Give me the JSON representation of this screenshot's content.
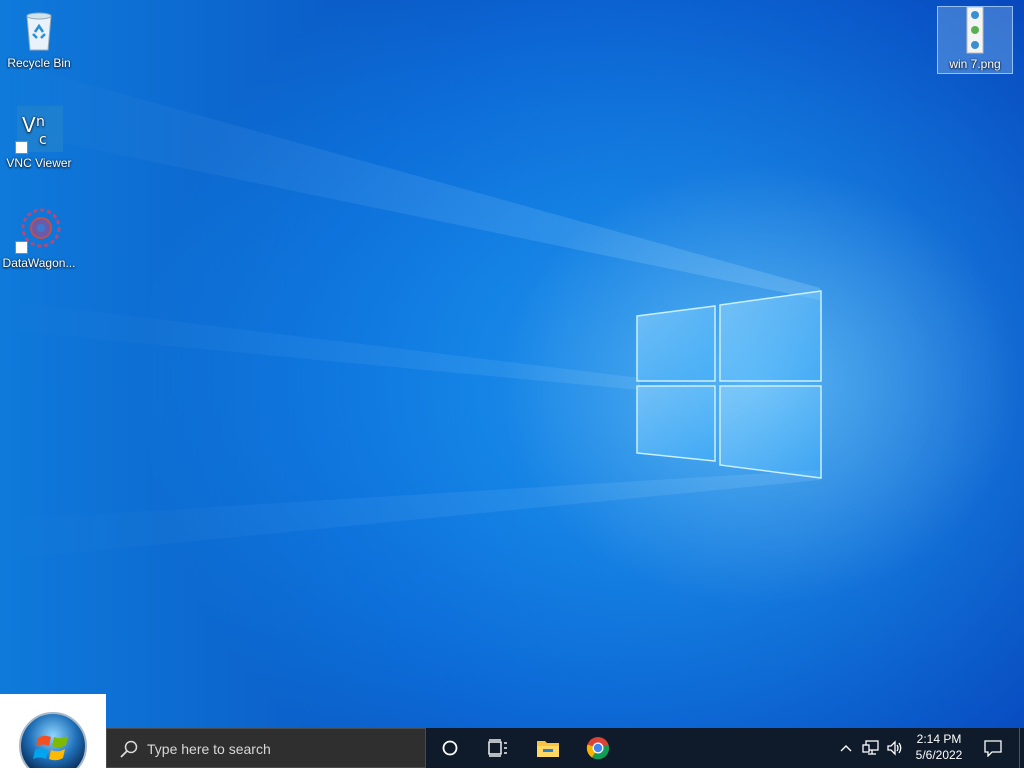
{
  "desktop": {
    "icons": [
      {
        "label": "Recycle Bin",
        "icon": "recycle-bin-icon"
      },
      {
        "label": "VNC Viewer",
        "icon": "vnc-viewer-icon"
      },
      {
        "label": "DataWagon...",
        "icon": "datawagon-icon"
      },
      {
        "label": "win 7.png",
        "icon": "png-file-icon"
      }
    ],
    "wallpaper": "windows-10-light-logo",
    "colors": {
      "wallpaper_light": "#2fa0f0",
      "wallpaper_dark": "#0640b4"
    }
  },
  "taskbar": {
    "start_icon": "windows-7-start-orb-icon",
    "search_placeholder": "Type here to search",
    "buttons": [
      "cortana-icon",
      "task-view-icon",
      "file-explorer-icon",
      "chrome-icon"
    ],
    "tray": [
      "show-hidden-icons-chevron-icon",
      "network-icon",
      "volume-icon"
    ],
    "time": "2:14 PM",
    "date": "5/6/2022",
    "notification_icon": "action-center-icon",
    "colors": {
      "taskbar": "#0f1b2a",
      "search_box": "#2f2f2f"
    }
  }
}
